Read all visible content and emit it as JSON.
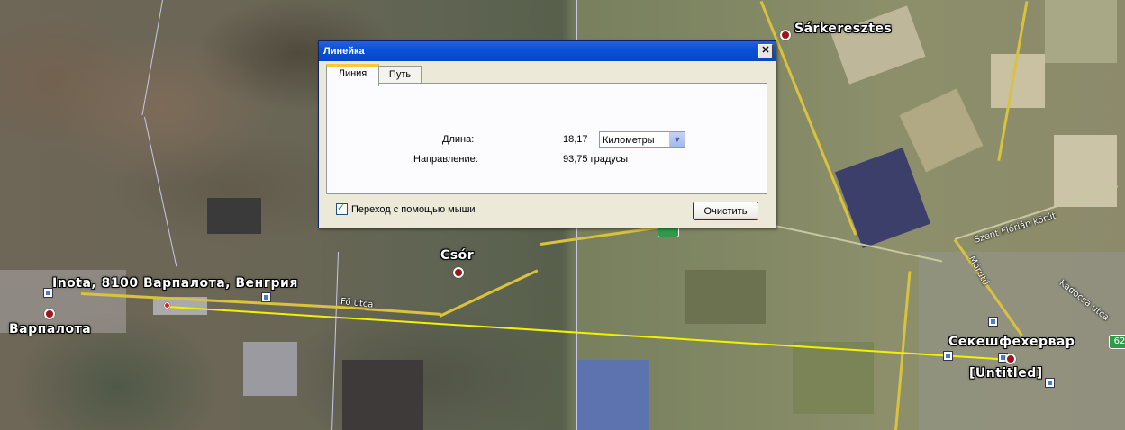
{
  "map": {
    "places": [
      {
        "id": "sarkeresztes",
        "label": "Sárkeresztes"
      },
      {
        "id": "csor",
        "label": "Csór"
      },
      {
        "id": "inota",
        "label": "Inota, 8100 Варпалота, Венгрия"
      },
      {
        "id": "varpalota",
        "label": "Варпалота"
      },
      {
        "id": "szekesfehervar",
        "label": "Секешфехервар"
      },
      {
        "id": "untitled",
        "label": "[Untitled]"
      }
    ],
    "streets": {
      "fo_utca": "Fő utca",
      "szent_florian": "Szent Flórián körút",
      "mornut": "Mórutú",
      "kadocsa": "Kadocsa utca"
    },
    "road_shield": "62"
  },
  "ruler": {
    "title": "Линейка",
    "close_glyph": "✕",
    "tabs": [
      "Линия",
      "Путь"
    ],
    "active_tab": "Линия",
    "length_label": "Длина:",
    "length_value": "18,17",
    "unit_selected": "Километры",
    "direction_label": "Направление:",
    "direction_value": "93,75 градусы",
    "mouse_nav_label": "Переход с помощью мыши",
    "mouse_nav_checked": true,
    "clear_label": "Очистить"
  }
}
